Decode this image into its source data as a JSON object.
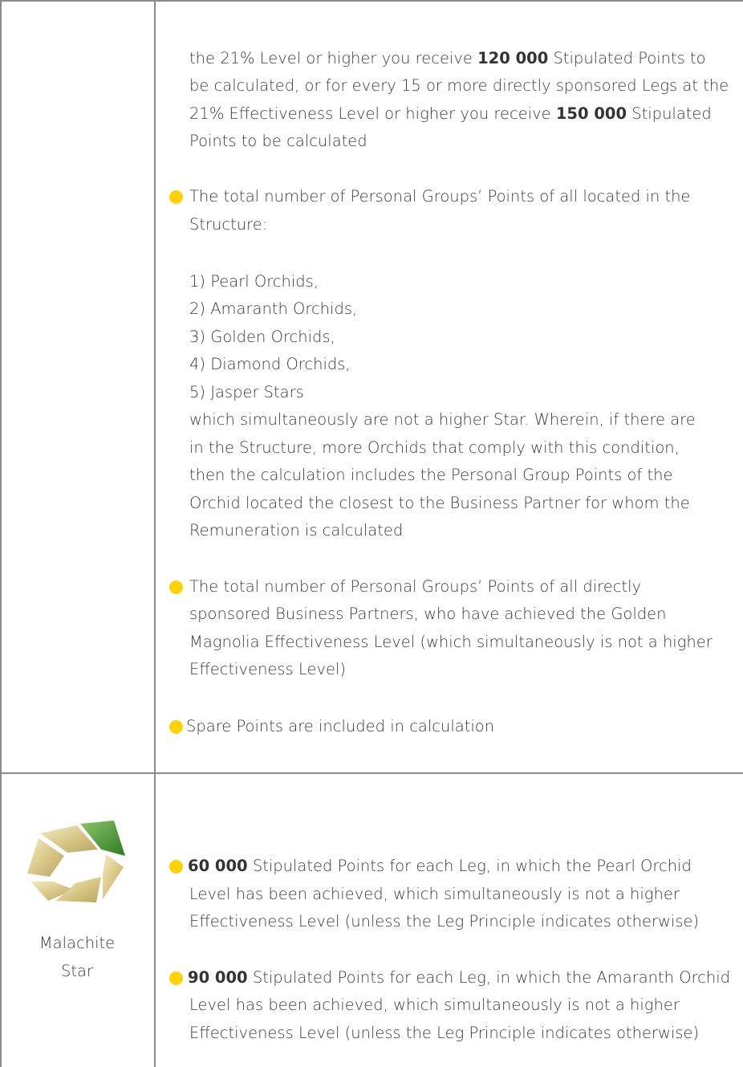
{
  "upper": {
    "intro_lines": [
      {
        "pre": "the 21% Level or higher you receive ",
        "bold": "120 000",
        "post": " Stipulated Points to"
      },
      {
        "pre": "be calculated, or for every 15 or more directly sponsored Legs at the",
        "bold": "",
        "post": ""
      },
      {
        "pre": "21% Effectiveness Level or higher you receive ",
        "bold": "150 000",
        "post": " Stipulated"
      },
      {
        "pre": "Points to be calculated",
        "bold": "",
        "post": ""
      }
    ],
    "bullet1_lines": [
      "The total number of Personal Groups’ Points of all located in the",
      "Structure:"
    ],
    "list_items": [
      "1) Pearl Orchids,",
      "2) Amaranth Orchids,",
      "3) Golden Orchids,",
      "4) Diamond Orchids,",
      "5) Jasper Stars"
    ],
    "after_list_lines": [
      "which simultaneously are not a higher Star. Wherein, if there are",
      "in the Structure, more Orchids that comply with this condition,",
      "then the calculation includes the Personal Group Points of the",
      "Orchid located the closest to the Business Partner for whom the",
      "Remuneration is calculated"
    ],
    "bullet2_lines": [
      "The total number of Personal Groups’ Points of all directly",
      "sponsored Business Partners, who have achieved the Golden",
      "Magnolia Effectiveness Level (which simultaneously is not a higher",
      "Effectiveness Level)"
    ],
    "bullet3_line": "Spare Points are included in calculation"
  },
  "lower": {
    "star_name_lines": [
      "Malachite",
      "Star"
    ],
    "bullet4": {
      "bold": "60 000",
      "lines": [
        " Stipulated Points for each Leg, in which the Pearl Orchid",
        "Level has been achieved, which simultaneously is not a higher",
        "Effectiveness Level  (unless the Leg Principle indicates otherwise)"
      ]
    },
    "bullet5": {
      "bold": "90 000",
      "lines": [
        " Stipulated Points for each Leg, in which the Amaranth Orchid",
        "Level has been achieved, which simultaneously is not a higher",
        "Effectiveness Level  (unless the Leg Principle indicates otherwise)"
      ]
    }
  },
  "colors": {
    "bullet": "#fdd20a",
    "rule": "#8c8c8c",
    "logo_green": "#3f8b2b",
    "logo_gold": "#d9c98a"
  }
}
